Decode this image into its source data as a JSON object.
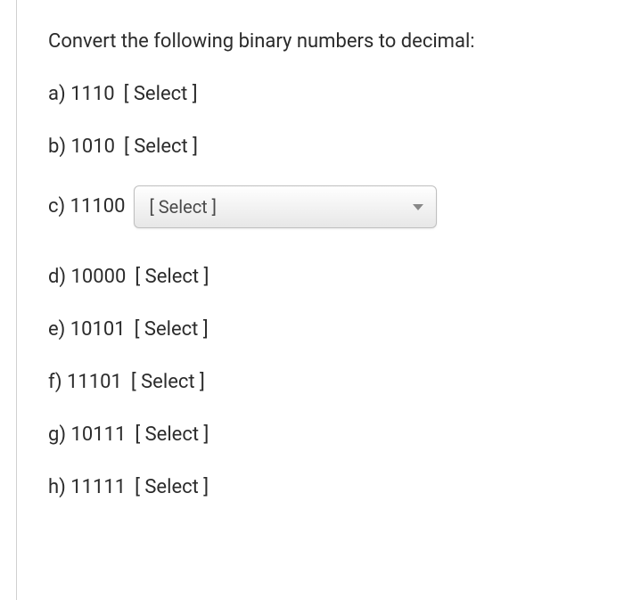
{
  "prompt": "Convert the following binary numbers to decimal:",
  "select_placeholder": "[ Select ]",
  "questions": [
    {
      "letter": "a)",
      "value": "1110",
      "dropdown": false
    },
    {
      "letter": "b)",
      "value": "1010",
      "dropdown": false
    },
    {
      "letter": "c)",
      "value": "11100",
      "dropdown": true
    },
    {
      "letter": "d)",
      "value": "10000",
      "dropdown": false
    },
    {
      "letter": "e)",
      "value": "10101",
      "dropdown": false
    },
    {
      "letter": "f)",
      "value": "11101",
      "dropdown": false
    },
    {
      "letter": "g)",
      "value": "10111",
      "dropdown": false
    },
    {
      "letter": "h)",
      "value": "11111",
      "dropdown": false
    }
  ]
}
